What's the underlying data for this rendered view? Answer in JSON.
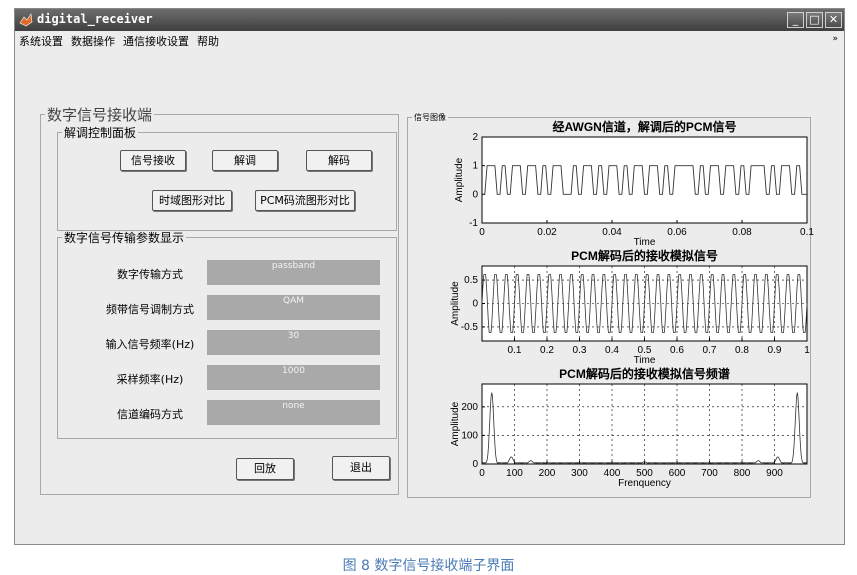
{
  "window": {
    "title": "digital_receiver",
    "controls": [
      "_",
      "□",
      "✕"
    ]
  },
  "menu": {
    "items": [
      "系统设置",
      "数据操作",
      "通信接收设置",
      "帮助"
    ],
    "overflow_arrow": "»"
  },
  "main_panel": {
    "title": "数字信号接收端",
    "control_panel": {
      "title": "解调控制面板",
      "buttons": {
        "receive": "信号接收",
        "demodulate": "解调",
        "decode": "解码",
        "time_compare": "时域图形对比",
        "pcm_compare": "PCM码流图形对比"
      }
    },
    "param_panel": {
      "title": "数字信号传输参数显示",
      "rows": [
        {
          "label": "数字传输方式",
          "value": "passband"
        },
        {
          "label": "频带信号调制方式",
          "value": "QAM"
        },
        {
          "label": "输入信号频率(Hz)",
          "value": "30"
        },
        {
          "label": "采样频率(Hz)",
          "value": "1000"
        },
        {
          "label": "信道编码方式",
          "value": "none"
        }
      ]
    },
    "buttons": {
      "replay": "回放",
      "exit": "退出"
    }
  },
  "plot_panel": {
    "title": "信号图像"
  },
  "chart_data": [
    {
      "type": "line",
      "title": "经AWGN信道，解调后的PCM信号",
      "xlabel": "Time",
      "ylabel": "Amplitude",
      "xlim": [
        0,
        0.1
      ],
      "ylim": [
        -1,
        2
      ],
      "xticks": [
        "0",
        "0.02",
        "0.04",
        "0.06",
        "0.08",
        "0.1"
      ],
      "yticks": [
        "-1",
        "0",
        "1",
        "2"
      ],
      "grid": false,
      "series": [
        {
          "values": [
            0,
            1,
            1,
            0,
            1,
            0,
            1,
            1,
            0,
            1,
            1,
            0,
            1,
            0,
            1,
            1,
            0,
            0,
            1,
            0,
            1,
            1,
            0,
            1,
            0,
            1,
            1,
            0,
            1,
            0,
            1,
            1,
            0,
            1,
            1,
            0,
            1,
            0,
            1,
            1,
            1,
            1,
            0,
            1,
            0,
            1,
            1,
            0,
            1,
            1,
            0,
            1,
            0,
            1,
            1,
            1,
            0,
            1,
            0,
            1,
            1,
            0,
            1,
            0
          ]
        }
      ]
    },
    {
      "type": "line",
      "title": "PCM解码后的接收模拟信号",
      "xlabel": "Time",
      "ylabel": "Amplitude",
      "xlim": [
        0,
        1
      ],
      "ylim": [
        -0.8,
        0.8
      ],
      "xticks": [
        "0.1",
        "0.2",
        "0.3",
        "0.4",
        "0.5",
        "0.6",
        "0.7",
        "0.8",
        "0.9",
        "1"
      ],
      "yticks": [
        "-0.5",
        "0",
        "0.5"
      ],
      "grid": true,
      "series": [
        {
          "frequency_hz": 30,
          "amplitude": 0.62
        }
      ]
    },
    {
      "type": "line",
      "title": "PCM解码后的接收模拟信号频谱",
      "xlabel": "Frenquency",
      "ylabel": "Amplitude",
      "xlim": [
        0,
        1000
      ],
      "ylim": [
        0,
        280
      ],
      "xticks": [
        "0",
        "100",
        "200",
        "300",
        "400",
        "500",
        "600",
        "700",
        "800",
        "900"
      ],
      "yticks": [
        "0",
        "100",
        "200"
      ],
      "grid": true,
      "series": [
        {
          "peaks": [
            [
              30,
              250
            ],
            [
              970,
              250
            ],
            [
              90,
              25
            ],
            [
              910,
              25
            ],
            [
              150,
              12
            ],
            [
              850,
              12
            ],
            [
              500,
              8
            ]
          ]
        }
      ]
    }
  ],
  "caption": "图 8 数字信号接收端子界面"
}
